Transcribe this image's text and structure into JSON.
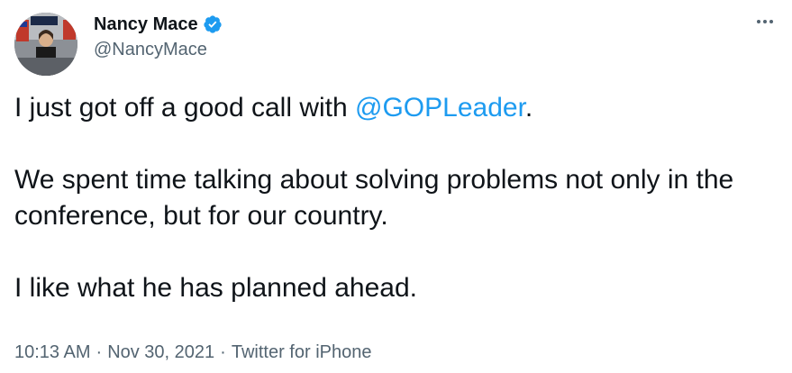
{
  "author": {
    "display_name": "Nancy Mace",
    "handle": "@NancyMace",
    "verified": true
  },
  "more_icon": "more-dots-icon",
  "tweet": {
    "line1_prefix": "I just got off a good call with ",
    "mention": "@GOPLeader",
    "line1_suffix": ".",
    "para2": "We spent time talking about solving problems not only in the conference, but for our country.",
    "para3": "I like what he has planned ahead."
  },
  "meta": {
    "time": "10:13 AM",
    "separator": "·",
    "date": "Nov 30, 2021",
    "source": "Twitter for iPhone"
  },
  "colors": {
    "accent": "#1d9bf0",
    "text": "#0f1419",
    "muted": "#536471"
  }
}
